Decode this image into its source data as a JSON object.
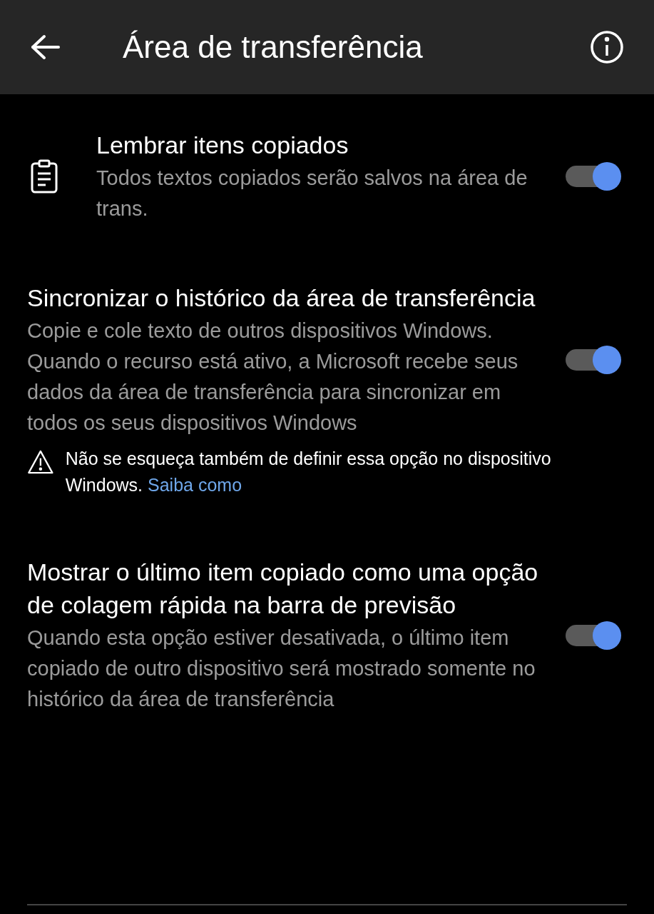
{
  "header": {
    "title": "Área de transferência"
  },
  "settings": [
    {
      "kind": "with-icon",
      "title": "Lembrar itens copiados",
      "description": "Todos textos copiados serão salvos na área de trans.",
      "on": true
    },
    {
      "kind": "plain",
      "title": "Sincronizar o histórico da área de transferência",
      "description": "Copie e cole texto de outros dispositivos Windows. Quando o recurso está ativo, a Microsoft recebe seus dados da área de transferência para sincronizar em todos os seus dispositivos Windows",
      "on": true,
      "note": {
        "text": "Não se esqueça também de definir essa opção no dispositivo Windows.",
        "link": "Saiba como"
      }
    },
    {
      "kind": "plain",
      "title": "Mostrar o último item copiado como uma opção de colagem rápida na barra de previsão",
      "description": "Quando esta opção estiver desativada, o último item copiado de outro dispositivo será mostrado somente no histórico da área de transferência",
      "on": true
    }
  ]
}
